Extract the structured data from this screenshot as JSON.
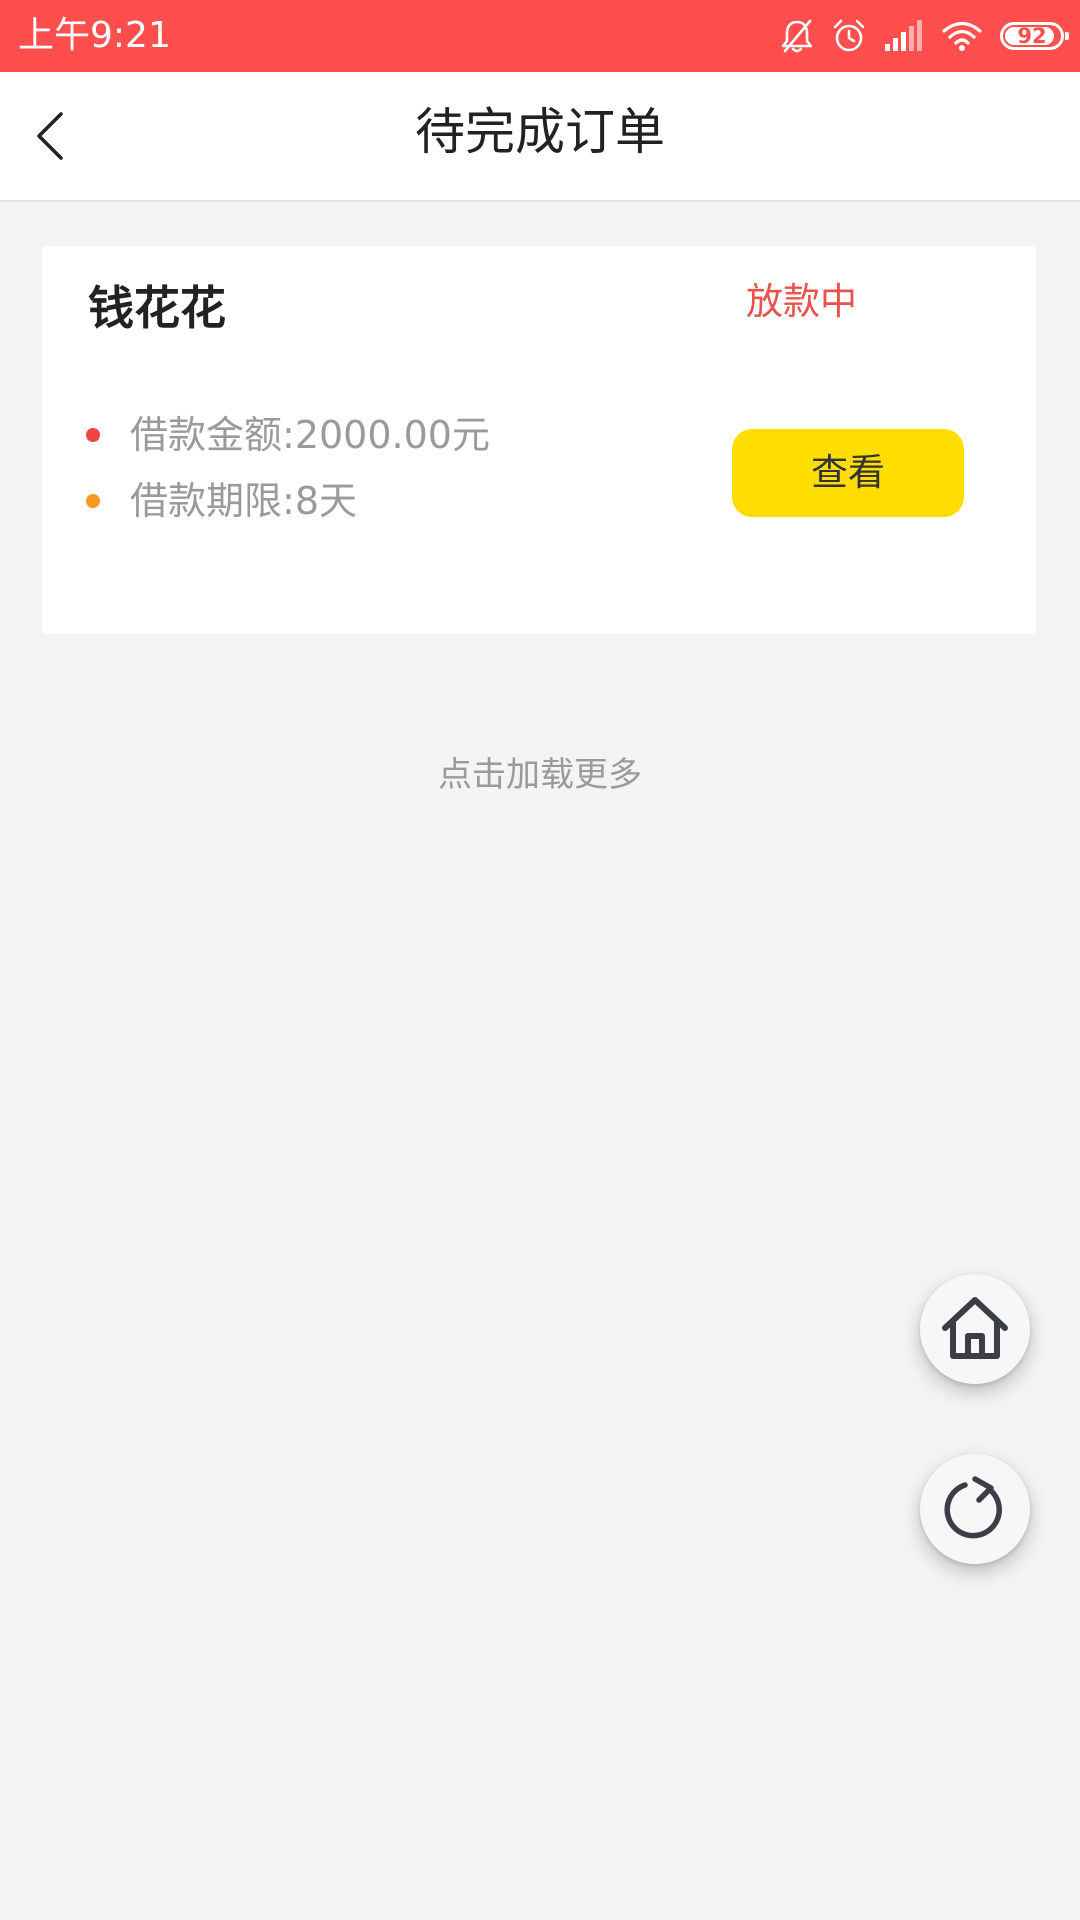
{
  "status_bar": {
    "time": "上午9:21",
    "battery_level": "92",
    "background_color": "#fe4e4e"
  },
  "header": {
    "title": "待完成订单",
    "back_icon": "chevron-left-icon"
  },
  "orders": [
    {
      "name": "钱花花",
      "status": "放款中",
      "status_color": "#e8534d",
      "details": [
        {
          "label": "借款金额:",
          "value": "2000.00元",
          "dot_color": "#ef4444"
        },
        {
          "label": "借款期限:",
          "value": "8天",
          "dot_color": "#f59a23"
        }
      ],
      "action_label": "查看",
      "action_color": "#ffdd00"
    }
  ],
  "load_more": "点击加载更多",
  "floating_buttons": {
    "home_icon": "home-icon",
    "refresh_icon": "refresh-icon"
  }
}
